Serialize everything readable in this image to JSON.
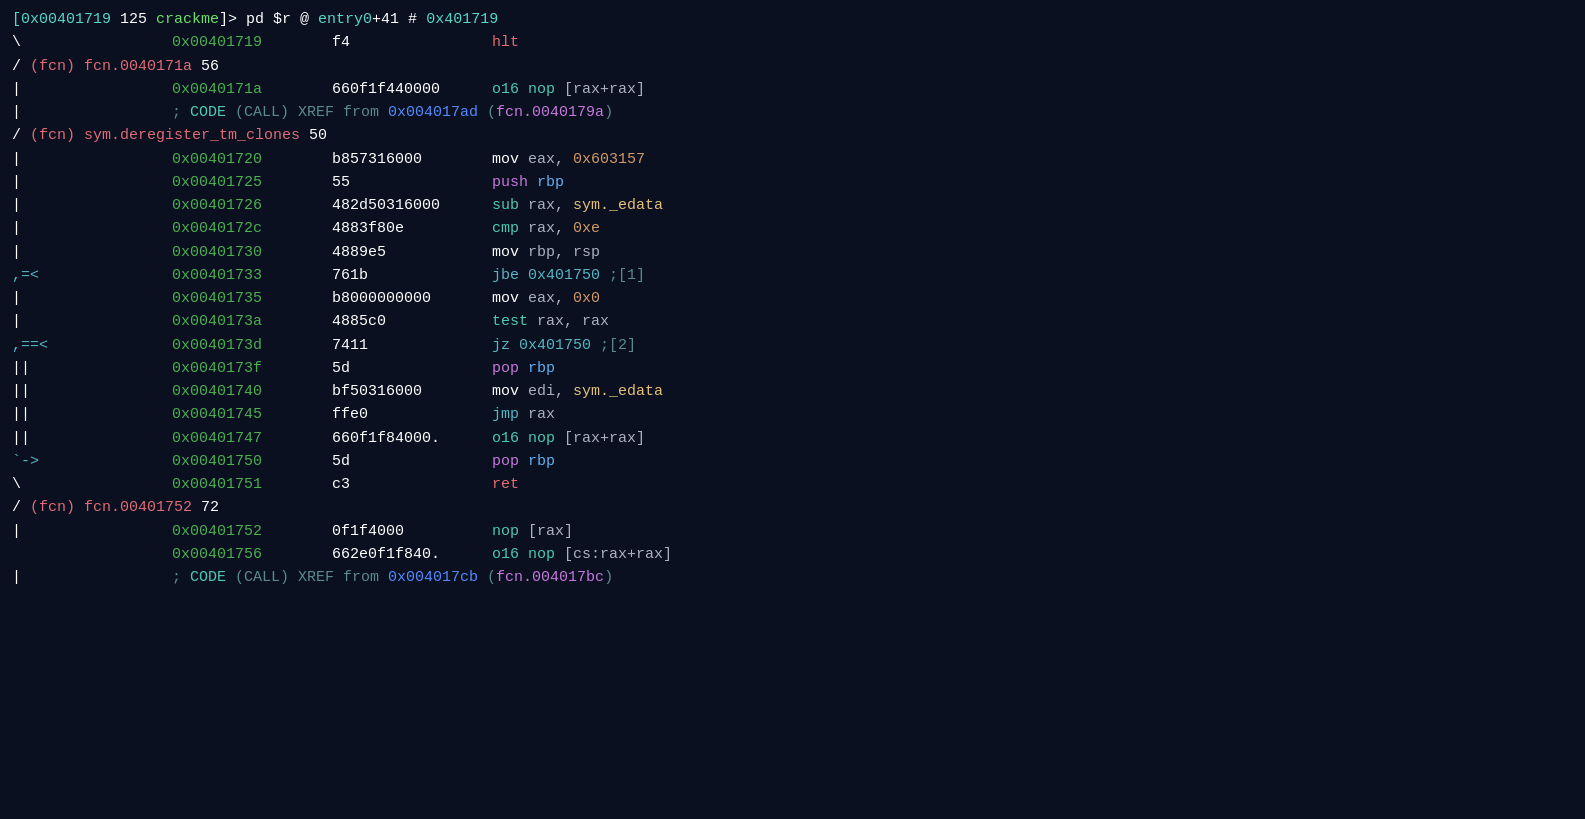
{
  "terminal": {
    "prompt_line": "[0x00401719 125 crackme]> pd $r @ entry0+41 # 0x401719",
    "lines": [
      {
        "id": "line1",
        "indent": "\\",
        "addr": "0x00401719",
        "bytes": "f4",
        "disasm": "hlt"
      }
    ],
    "colors": {
      "background": "#0a1020",
      "green": "#4caf50",
      "red": "#e06c75",
      "cyan": "#4ec9b0",
      "magenta": "#c678dd",
      "orange": "#d19a66",
      "blue": "#61afef",
      "teal": "#56b6c2",
      "comment": "#528bff"
    }
  }
}
